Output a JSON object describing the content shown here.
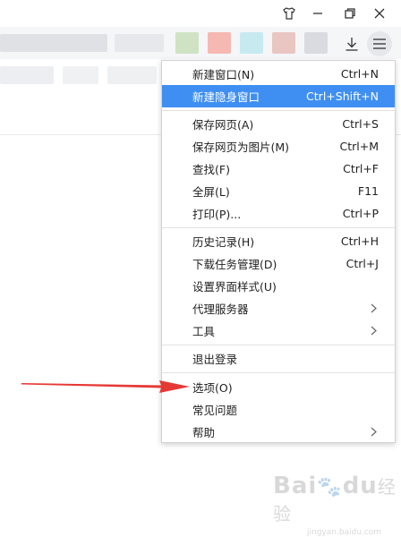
{
  "menu": {
    "items": [
      {
        "label": "新建窗口(N)",
        "shortcut": "Ctrl+N"
      },
      {
        "label": "新建隐身窗口",
        "shortcut": "Ctrl+Shift+N"
      },
      {
        "label": "保存网页(A)",
        "shortcut": "Ctrl+S"
      },
      {
        "label": "保存网页为图片(M)",
        "shortcut": "Ctrl+M"
      },
      {
        "label": "查找(F)",
        "shortcut": "Ctrl+F"
      },
      {
        "label": "全屏(L)",
        "shortcut": "F11"
      },
      {
        "label": "打印(P)...",
        "shortcut": "Ctrl+P"
      },
      {
        "label": "历史记录(H)",
        "shortcut": "Ctrl+H"
      },
      {
        "label": "下载任务管理(D)",
        "shortcut": "Ctrl+J"
      },
      {
        "label": "设置界面样式(U)",
        "shortcut": ""
      },
      {
        "label": "代理服务器",
        "shortcut": ""
      },
      {
        "label": "工具",
        "shortcut": ""
      },
      {
        "label": "退出登录",
        "shortcut": ""
      },
      {
        "label": "选项(O)",
        "shortcut": ""
      },
      {
        "label": "常见问题",
        "shortcut": ""
      },
      {
        "label": "帮助",
        "shortcut": ""
      }
    ]
  },
  "colors": {
    "highlight": "#3f8ff3",
    "arrow": "#e53935"
  },
  "watermark": {
    "logo_text": "Bai",
    "paw_text": "du",
    "cn_text": "经验",
    "sub_text": "jingyan.baidu.com"
  }
}
